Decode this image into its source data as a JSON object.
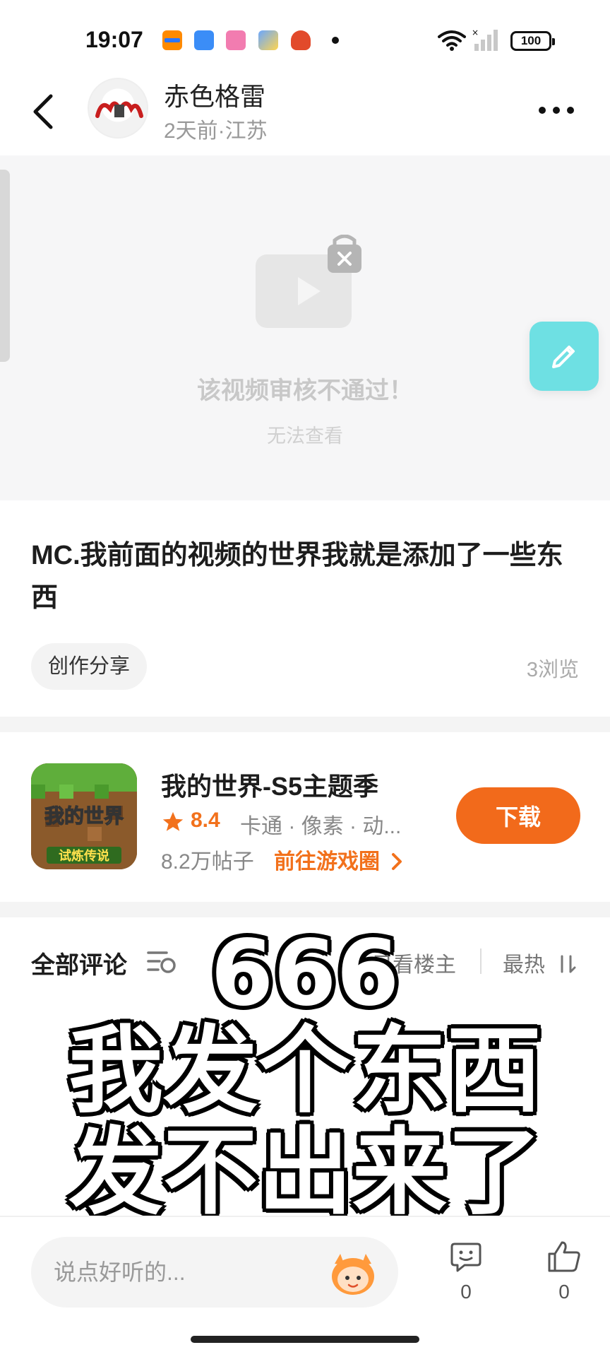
{
  "status_bar": {
    "time": "19:07",
    "battery": "100",
    "icons": [
      "notification-app-icon",
      "notification-app-icon",
      "notification-app-icon",
      "notification-app-icon",
      "notification-app-icon",
      "wifi-icon",
      "signal-icon",
      "battery-icon"
    ]
  },
  "header": {
    "author_name": "赤色格雷",
    "author_meta": "2天前·江苏",
    "icons": [
      "back-icon",
      "avatar",
      "more-icon"
    ]
  },
  "video": {
    "blocked_title": "该视频审核不通过！",
    "blocked_subtitle": "无法查看",
    "icon": "lock-video-icon"
  },
  "post": {
    "title": "MC.我前面的视频的世界我就是添加了一些东西",
    "tag": "创作分享",
    "views": "3浏览"
  },
  "game_card": {
    "icon_text": "我的世界",
    "icon_subtext": "试炼传说",
    "name": "我的世界-S5主题季",
    "rating": "8.4",
    "tags": "卡通 · 像素 · 动...",
    "posts": "8.2万帖子",
    "link": "前往游戏圈",
    "download_label": "下载"
  },
  "comments": {
    "title": "全部评论",
    "only_op": "只看楼主",
    "sort": "最热"
  },
  "overlay_caption": {
    "line1": "666",
    "line2": "我发个东西",
    "line3": "发不出来了"
  },
  "bottom_bar": {
    "input_placeholder": "说点好听的...",
    "reply_count": "0",
    "like_count": "0"
  },
  "colors": {
    "accent_orange": "#f26a1b",
    "fab_cyan": "#6ee0e3",
    "muted": "#999999"
  }
}
